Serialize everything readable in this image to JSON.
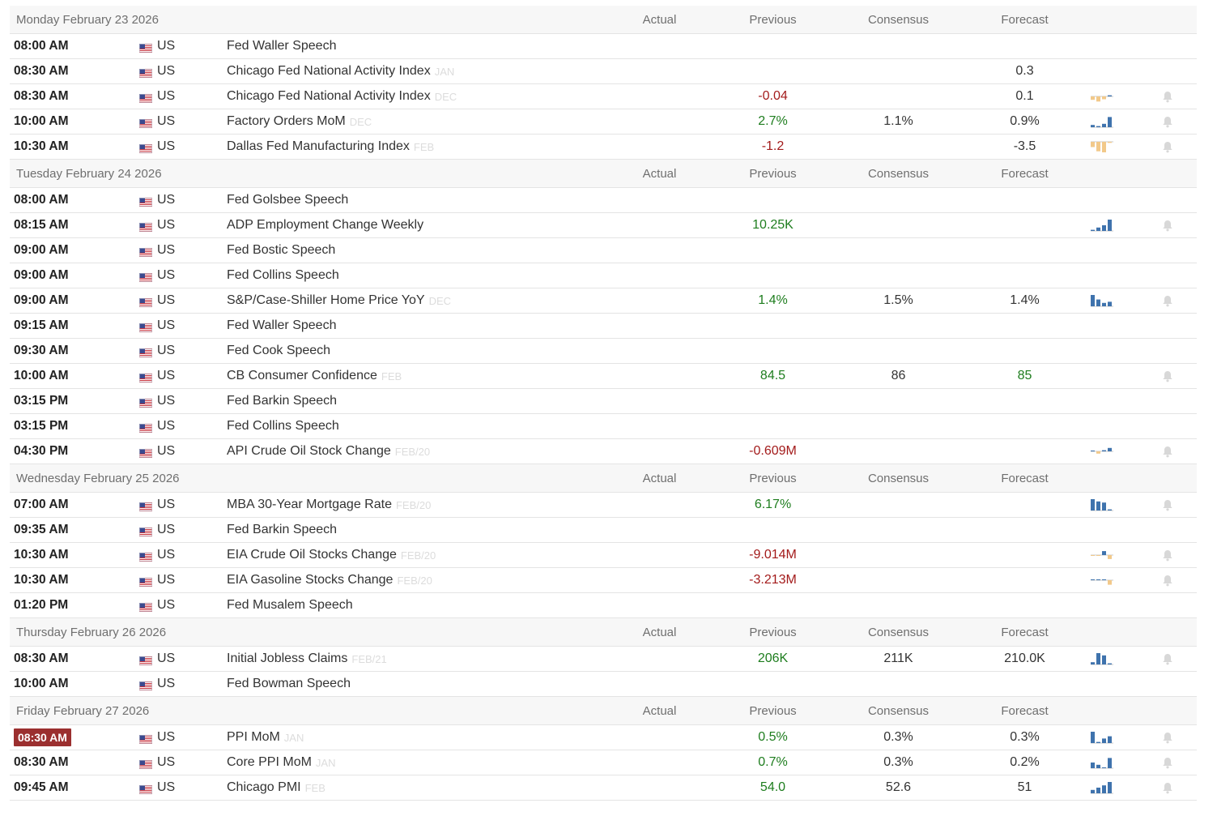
{
  "columns": {
    "actual": "Actual",
    "previous": "Previous",
    "consensus": "Consensus",
    "forecast": "Forecast"
  },
  "colors": {
    "positive": "#1e7d1e",
    "negative": "#a31b1b",
    "spark_blue": "#3f73ad",
    "spark_orange": "#f2c98a",
    "bell": "#d8d8d8",
    "highlight_time": "#9b2f2f"
  },
  "icons": {
    "flag": "us-flag-icon",
    "bell": "bell-icon",
    "sparkline": "sparkline-icon"
  },
  "days": [
    {
      "date": "Monday February 23 2026",
      "events": [
        {
          "time": "08:00 AM",
          "country": "US",
          "event": "Fed Waller Speech",
          "ref": "",
          "previous": "",
          "previous_tone": "neu",
          "consensus": "",
          "forecast": "",
          "forecast_tone": "neu",
          "spark": [],
          "bell": false
        },
        {
          "time": "08:30 AM",
          "country": "US",
          "event": "Chicago Fed National Activity Index",
          "ref": "JAN",
          "previous": "",
          "previous_tone": "neu",
          "consensus": "",
          "forecast": "0.3",
          "forecast_tone": "neu",
          "spark": [],
          "bell": false
        },
        {
          "time": "08:30 AM",
          "country": "US",
          "event": "Chicago Fed National Activity Index",
          "ref": "DEC",
          "previous": "-0.04",
          "previous_tone": "neg",
          "consensus": "",
          "forecast": "0.1",
          "forecast_tone": "neu",
          "spark": [
            -0.6,
            -0.9,
            -0.5,
            0.2
          ],
          "bell": true
        },
        {
          "time": "10:00 AM",
          "country": "US",
          "event": "Factory Orders MoM",
          "ref": "DEC",
          "previous": "2.7%",
          "previous_tone": "pos",
          "consensus": "1.1%",
          "forecast": "0.9%",
          "forecast_tone": "neu",
          "spark": [
            0.2,
            0.1,
            0.3,
            0.9
          ],
          "bell": true
        },
        {
          "time": "10:30 AM",
          "country": "US",
          "event": "Dallas Fed Manufacturing Index",
          "ref": "FEB",
          "previous": "-1.2",
          "previous_tone": "neg",
          "consensus": "",
          "forecast": "-3.5",
          "forecast_tone": "neu",
          "spark": [
            -0.5,
            -0.9,
            -1.0,
            -0.1
          ],
          "bell": true
        }
      ]
    },
    {
      "date": "Tuesday February 24 2026",
      "events": [
        {
          "time": "08:00 AM",
          "country": "US",
          "event": "Fed Golsbee Speech",
          "ref": "",
          "previous": "",
          "previous_tone": "neu",
          "consensus": "",
          "forecast": "",
          "forecast_tone": "neu",
          "spark": [],
          "bell": false
        },
        {
          "time": "08:15 AM",
          "country": "US",
          "event": "ADP Employment Change Weekly",
          "ref": "",
          "previous": "10.25K",
          "previous_tone": "pos",
          "consensus": "",
          "forecast": "",
          "forecast_tone": "neu",
          "spark": [
            0.1,
            0.3,
            0.5,
            1.0
          ],
          "bell": true
        },
        {
          "time": "09:00 AM",
          "country": "US",
          "event": "Fed Bostic Speech",
          "ref": "",
          "previous": "",
          "previous_tone": "neu",
          "consensus": "",
          "forecast": "",
          "forecast_tone": "neu",
          "spark": [],
          "bell": false
        },
        {
          "time": "09:00 AM",
          "country": "US",
          "event": "Fed Collins Speech",
          "ref": "",
          "previous": "",
          "previous_tone": "neu",
          "consensus": "",
          "forecast": "",
          "forecast_tone": "neu",
          "spark": [],
          "bell": false
        },
        {
          "time": "09:00 AM",
          "country": "US",
          "event": "S&P/Case-Shiller Home Price YoY",
          "ref": "DEC",
          "previous": "1.4%",
          "previous_tone": "pos",
          "consensus": "1.5%",
          "forecast": "1.4%",
          "forecast_tone": "neu",
          "spark": [
            1.0,
            0.6,
            0.3,
            0.4
          ],
          "bell": true
        },
        {
          "time": "09:15 AM",
          "country": "US",
          "event": "Fed Waller Speech",
          "ref": "",
          "previous": "",
          "previous_tone": "neu",
          "consensus": "",
          "forecast": "",
          "forecast_tone": "neu",
          "spark": [],
          "bell": false
        },
        {
          "time": "09:30 AM",
          "country": "US",
          "event": "Fed Cook Speech",
          "ref": "",
          "previous": "",
          "previous_tone": "neu",
          "consensus": "",
          "forecast": "",
          "forecast_tone": "neu",
          "spark": [],
          "bell": false
        },
        {
          "time": "10:00 AM",
          "country": "US",
          "event": "CB Consumer Confidence",
          "ref": "FEB",
          "previous": "84.5",
          "previous_tone": "pos",
          "consensus": "86",
          "forecast": "85",
          "forecast_tone": "pos",
          "spark": [],
          "bell": true
        },
        {
          "time": "03:15 PM",
          "country": "US",
          "event": "Fed Barkin Speech",
          "ref": "",
          "previous": "",
          "previous_tone": "neu",
          "consensus": "",
          "forecast": "",
          "forecast_tone": "neu",
          "spark": [],
          "bell": false
        },
        {
          "time": "03:15 PM",
          "country": "US",
          "event": "Fed Collins Speech",
          "ref": "",
          "previous": "",
          "previous_tone": "neu",
          "consensus": "",
          "forecast": "",
          "forecast_tone": "neu",
          "spark": [],
          "bell": false
        },
        {
          "time": "04:30 PM",
          "country": "US",
          "event": "API Crude Oil Stock Change",
          "ref": "FEB/20",
          "previous": "-0.609M",
          "previous_tone": "neg",
          "consensus": "",
          "forecast": "",
          "forecast_tone": "neu",
          "spark": [
            0.0,
            -0.4,
            0.2,
            0.6
          ],
          "bell": true
        }
      ]
    },
    {
      "date": "Wednesday February 25 2026",
      "events": [
        {
          "time": "07:00 AM",
          "country": "US",
          "event": "MBA 30-Year Mortgage Rate",
          "ref": "FEB/20",
          "previous": "6.17%",
          "previous_tone": "pos",
          "consensus": "",
          "forecast": "",
          "forecast_tone": "neu",
          "spark": [
            1.0,
            0.8,
            0.7,
            0.1
          ],
          "bell": true
        },
        {
          "time": "09:35 AM",
          "country": "US",
          "event": "Fed Barkin Speech",
          "ref": "",
          "previous": "",
          "previous_tone": "neu",
          "consensus": "",
          "forecast": "",
          "forecast_tone": "neu",
          "spark": [],
          "bell": false
        },
        {
          "time": "10:30 AM",
          "country": "US",
          "event": "EIA Crude Oil Stocks Change",
          "ref": "FEB/20",
          "previous": "-9.014M",
          "previous_tone": "neg",
          "consensus": "",
          "forecast": "",
          "forecast_tone": "neu",
          "spark": [
            -0.1,
            -0.1,
            0.7,
            -0.7
          ],
          "bell": true
        },
        {
          "time": "10:30 AM",
          "country": "US",
          "event": "EIA Gasoline Stocks Change",
          "ref": "FEB/20",
          "previous": "-3.213M",
          "previous_tone": "neg",
          "consensus": "",
          "forecast": "",
          "forecast_tone": "neu",
          "spark": [
            0.1,
            0.1,
            0.1,
            -0.8
          ],
          "bell": true
        },
        {
          "time": "01:20 PM",
          "country": "US",
          "event": "Fed Musalem Speech",
          "ref": "",
          "previous": "",
          "previous_tone": "neu",
          "consensus": "",
          "forecast": "",
          "forecast_tone": "neu",
          "spark": [],
          "bell": false
        }
      ]
    },
    {
      "date": "Thursday February 26 2026",
      "events": [
        {
          "time": "08:30 AM",
          "country": "US",
          "event": "Initial Jobless Claims",
          "ref": "FEB/21",
          "previous": "206K",
          "previous_tone": "pos",
          "consensus": "211K",
          "forecast": "210.0K",
          "forecast_tone": "neu",
          "spark": [
            0.2,
            1.0,
            0.8,
            0.1
          ],
          "bell": true
        },
        {
          "time": "10:00 AM",
          "country": "US",
          "event": "Fed Bowman Speech",
          "ref": "",
          "previous": "",
          "previous_tone": "neu",
          "consensus": "",
          "forecast": "",
          "forecast_tone": "neu",
          "spark": [],
          "bell": false
        }
      ]
    },
    {
      "date": "Friday February 27 2026",
      "events": [
        {
          "time": "08:30 AM",
          "highlight": true,
          "country": "US",
          "event": "PPI MoM",
          "ref": "JAN",
          "previous": "0.5%",
          "previous_tone": "pos",
          "consensus": "0.3%",
          "forecast": "0.3%",
          "forecast_tone": "neu",
          "spark": [
            1.0,
            0.1,
            0.4,
            0.6
          ],
          "bell": true
        },
        {
          "time": "08:30 AM",
          "country": "US",
          "event": "Core PPI MoM",
          "ref": "JAN",
          "previous": "0.7%",
          "previous_tone": "pos",
          "consensus": "0.3%",
          "forecast": "0.2%",
          "forecast_tone": "neu",
          "spark": [
            0.5,
            0.3,
            0.0,
            0.9
          ],
          "bell": true
        },
        {
          "time": "09:45 AM",
          "country": "US",
          "event": "Chicago PMI",
          "ref": "FEB",
          "previous": "54.0",
          "previous_tone": "pos",
          "consensus": "52.6",
          "forecast": "51",
          "forecast_tone": "neu",
          "spark": [
            0.3,
            0.5,
            0.7,
            1.0
          ],
          "bell": true
        }
      ]
    }
  ]
}
